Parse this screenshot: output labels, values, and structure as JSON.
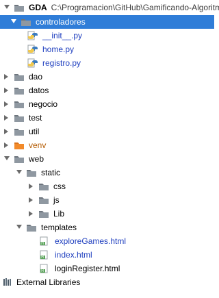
{
  "colors": {
    "selected_row": "#2f7dd8",
    "folder_icon": "#8f98a1",
    "venv_folder_icon": "#f28a2a",
    "python_file_text": "#1f3fbf",
    "html_file_badge": "#5aa45a"
  },
  "tree": {
    "root": {
      "label": "GDA",
      "path": "C:\\Programacion\\GitHub\\Gamificando-Algoritm",
      "icon": "folder-icon",
      "expanded": true
    },
    "items": [
      {
        "label": "controladores",
        "icon": "folder-icon",
        "chevron": "chevron-down-icon",
        "selected": true
      },
      {
        "label": "__init__.py",
        "icon": "python-file-icon"
      },
      {
        "label": "home.py",
        "icon": "python-file-icon"
      },
      {
        "label": "registro.py",
        "icon": "python-file-icon"
      },
      {
        "label": "dao",
        "icon": "folder-icon",
        "chevron": "chevron-right-icon"
      },
      {
        "label": "datos",
        "icon": "folder-icon",
        "chevron": "chevron-right-icon"
      },
      {
        "label": "negocio",
        "icon": "folder-icon",
        "chevron": "chevron-right-icon"
      },
      {
        "label": "test",
        "icon": "folder-icon",
        "chevron": "chevron-right-icon"
      },
      {
        "label": "util",
        "icon": "folder-icon",
        "chevron": "chevron-right-icon"
      },
      {
        "label": "venv",
        "icon": "venv-folder-icon",
        "chevron": "chevron-right-icon"
      },
      {
        "label": "web",
        "icon": "folder-icon",
        "chevron": "chevron-down-icon"
      },
      {
        "label": "static",
        "icon": "folder-icon",
        "chevron": "chevron-down-icon"
      },
      {
        "label": "css",
        "icon": "folder-icon",
        "chevron": "chevron-right-icon"
      },
      {
        "label": "js",
        "icon": "folder-icon",
        "chevron": "chevron-right-icon"
      },
      {
        "label": "Lib",
        "icon": "folder-icon",
        "chevron": "chevron-right-icon"
      },
      {
        "label": "templates",
        "icon": "folder-icon",
        "chevron": "chevron-down-icon"
      },
      {
        "label": "exploreGames.html",
        "icon": "html-file-icon"
      },
      {
        "label": "index.html",
        "icon": "html-file-icon"
      },
      {
        "label": "loginRegister.html",
        "icon": "html-file-icon"
      }
    ],
    "external_libraries": {
      "label": "External Libraries",
      "icon": "libraries-icon",
      "chevron": "chevron-right-icon"
    }
  }
}
